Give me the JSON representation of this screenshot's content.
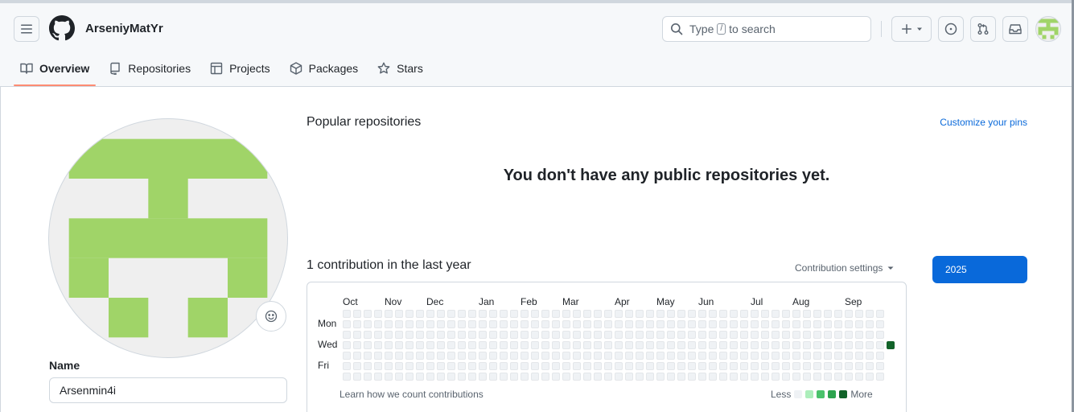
{
  "header": {
    "username": "ArseniyMatYr",
    "search_prefix": "Type",
    "search_key": "/",
    "search_suffix": "to search"
  },
  "nav": {
    "tabs": [
      {
        "label": "Overview",
        "icon": "book-icon",
        "selected": true
      },
      {
        "label": "Repositories",
        "icon": "repo-icon",
        "selected": false
      },
      {
        "label": "Projects",
        "icon": "table-icon",
        "selected": false
      },
      {
        "label": "Packages",
        "icon": "package-icon",
        "selected": false
      },
      {
        "label": "Stars",
        "icon": "star-icon",
        "selected": false
      }
    ]
  },
  "profile": {
    "name_label": "Name",
    "name_value": "Arsenmin4i",
    "avatar_color": "#a0d468",
    "avatar_bg": "#efefef"
  },
  "popular": {
    "title": "Popular repositories",
    "customize_link": "Customize your pins",
    "empty_message": "You don't have any public repositories yet."
  },
  "contributions": {
    "title": "1 contribution in the last year",
    "settings_label": "Contribution settings",
    "year_button": "2025",
    "months": [
      "Oct",
      "Nov",
      "Dec",
      "Jan",
      "Feb",
      "Mar",
      "Apr",
      "May",
      "Jun",
      "Jul",
      "Aug",
      "Sep"
    ],
    "day_labels": [
      "Mon",
      "Wed",
      "Fri"
    ],
    "learn_link": "Learn how we count contributions",
    "legend_less": "Less",
    "legend_more": "More",
    "legend_colors": [
      "#eff2f5",
      "#aceebb",
      "#4ac26b",
      "#2da44e",
      "#116329"
    ],
    "active_cell": {
      "week": 52,
      "day": 3,
      "level": 4
    }
  }
}
